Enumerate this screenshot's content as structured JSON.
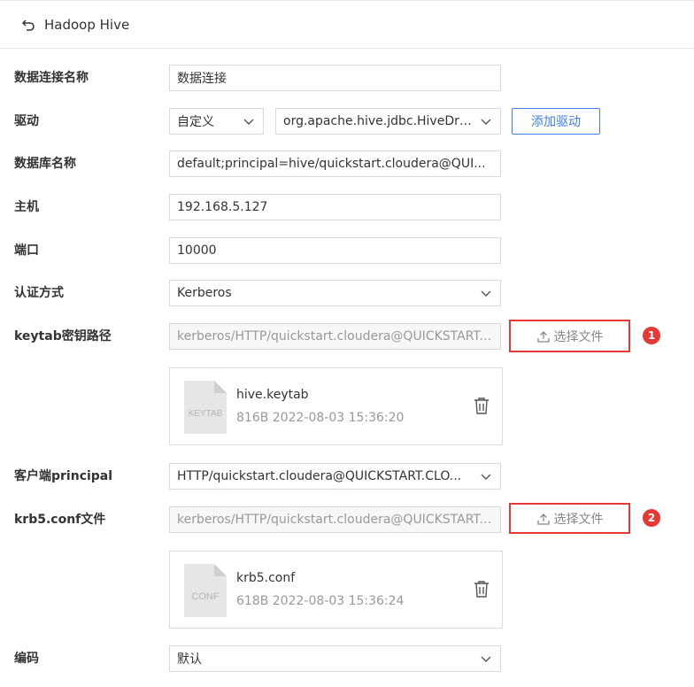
{
  "header": {
    "title": "Hadoop Hive"
  },
  "form": {
    "conn_name": {
      "label": "数据连接名称",
      "value": "数据连接"
    },
    "driver": {
      "label": "驱动",
      "type_value": "自定义",
      "class_value": "org.apache.hive.jdbc.HiveDri...",
      "add_label": "添加驱动"
    },
    "db_name": {
      "label": "数据库名称",
      "value": "default;principal=hive/quickstart.cloudera@QUI..."
    },
    "host": {
      "label": "主机",
      "value": "192.168.5.127"
    },
    "port": {
      "label": "端口",
      "value": "10000"
    },
    "auth": {
      "label": "认证方式",
      "value": "Kerberos"
    },
    "keytab": {
      "label": "keytab密钥路径",
      "value": "kerberos/HTTP/quickstart.cloudera@QUICKSTART....",
      "upload_label": "选择文件",
      "badge": "1",
      "file": {
        "icon_text": "KEYTAB",
        "name": "hive.keytab",
        "meta": "816B  2022-08-03 15:36:20"
      }
    },
    "principal": {
      "label": "客户端principal",
      "value": "HTTP/quickstart.cloudera@QUICKSTART.CLO..."
    },
    "krb5": {
      "label": "krb5.conf文件",
      "value": "kerberos/HTTP/quickstart.cloudera@QUICKSTART....",
      "upload_label": "选择文件",
      "badge": "2",
      "file": {
        "icon_text": "CONF",
        "name": "krb5.conf",
        "meta": "618B  2022-08-03 15:36:24"
      }
    },
    "encoding": {
      "label": "编码",
      "value": "默认"
    }
  },
  "colors": {
    "accent": "#3d7ff0",
    "highlight": "#e53935"
  },
  "icons": {
    "back": "back-arrow-icon",
    "chevron": "chevron-down-icon",
    "upload": "upload-icon",
    "delete": "trash-icon",
    "file": "file-icon"
  }
}
